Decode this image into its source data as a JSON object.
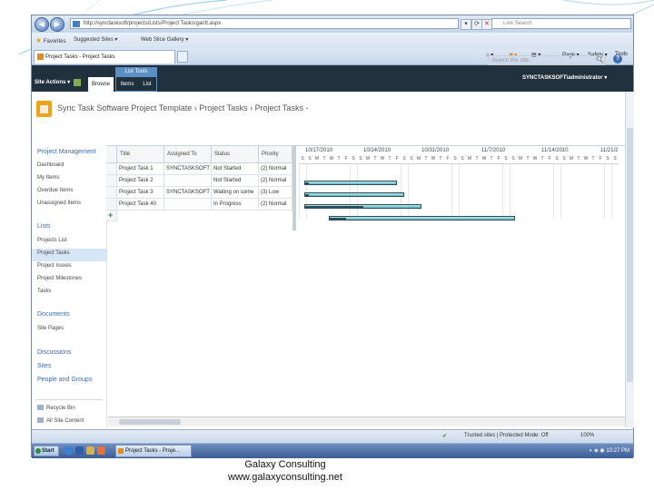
{
  "browser": {
    "address": "http://synctasksoft/projects/Lists/Project Tasks/gantt.aspx",
    "live_search_placeholder": "Live Search",
    "favorites_label": "Favorites",
    "suggested_sites": "Suggested Sites",
    "web_slice_gallery": "Web Slice Gallery",
    "tab_title": "Project Tasks - Project Tasks",
    "commands": {
      "page": "Page",
      "safety": "Safety",
      "tools": "Tools"
    }
  },
  "ribbon": {
    "site_actions": "Site Actions",
    "browse": "Browse",
    "list_tools": "List Tools",
    "items": "Items",
    "list": "List",
    "user": "SYNCTASKSOFT\\administrator"
  },
  "header": {
    "breadcrumb": "Sync Task Software Project Template › Project Tasks › Project Tasks -",
    "search_placeholder": "Search this site..."
  },
  "quick_launch": {
    "section_project_management": "Project Management",
    "items_pm": [
      "Dashboard",
      "My Items",
      "Overdue Items",
      "Unassigned Items"
    ],
    "section_lists": "Lists",
    "items_lists": [
      "Projects List",
      "Project Tasks",
      "Project Issues",
      "Project Milestones",
      "Tasks"
    ],
    "section_documents": "Documents",
    "items_documents": [
      "Site Pages"
    ],
    "discussions": "Discussions",
    "sites": "Sites",
    "people_groups": "People and Groups",
    "recycle_bin": "Recycle Bin",
    "all_site_content": "All Site Content"
  },
  "grid": {
    "columns": [
      "Title",
      "Assigned To",
      "Status",
      "Priority"
    ],
    "rows": [
      [
        "Project Task 1",
        "SYNCTASKSOFT",
        "Not Started",
        "(2) Normal"
      ],
      [
        "Project Task 2",
        "",
        "Not Started",
        "(2) Normal"
      ],
      [
        "Project Task 3",
        "SYNCTASKSOFT",
        "Waiting on some",
        "(3) Low"
      ],
      [
        "Project Task 40",
        "",
        "In Progress",
        "(2) Normal"
      ]
    ]
  },
  "gantt": {
    "weeks": [
      "10/17/2010",
      "10/24/2010",
      "10/31/2010",
      "11/7/2010",
      "11/14/2010",
      "11/21/2"
    ],
    "days": [
      "S",
      "S",
      "M",
      "T",
      "W",
      "T",
      "F",
      "S",
      "S",
      "M",
      "T",
      "W",
      "T",
      "F",
      "S",
      "S",
      "M",
      "T",
      "W",
      "T",
      "F",
      "S",
      "S",
      "M",
      "T",
      "W",
      "T",
      "F",
      "S",
      "S",
      "M",
      "T",
      "W",
      "T",
      "F",
      "S",
      "S",
      "M",
      "T",
      "W",
      "T",
      "F",
      "S",
      "S",
      "M"
    ]
  },
  "status_bar": {
    "trusted": "Trusted sites | Protected Mode: Off",
    "zoom": "100%"
  },
  "taskbar": {
    "start": "Start",
    "task": "Project Tasks - Proje...",
    "clock": "10:27 PM"
  },
  "caption": {
    "line1": "Galaxy Consulting",
    "line2": "www.galaxyconsulting.net"
  }
}
